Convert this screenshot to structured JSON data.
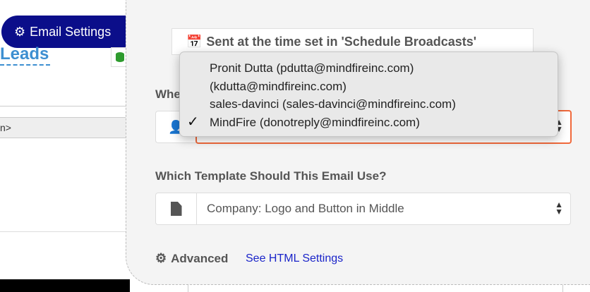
{
  "left": {
    "email_settings_tab": "Email Settings",
    "leads_link": "Leads",
    "table_header_fragment": "n>"
  },
  "panel": {
    "schedule_text": "Sent at the time set in 'Schedule Broadcasts'",
    "who_label_visible": "Whe",
    "from_dropdown": {
      "options": [
        "Pronit Dutta (pdutta@mindfireinc.com)",
        "(kdutta@mindfireinc.com)",
        "sales-davinci (sales-davinci@mindfireinc.com)",
        "MindFire (donotreply@mindfireinc.com)"
      ],
      "selected_index": 3
    },
    "template_label": "Which Template Should This Email Use?",
    "template_select_value": "Company: Logo and Button in Middle",
    "advanced_label": "Advanced",
    "html_settings_link": "See HTML Settings"
  },
  "icons": {
    "gears": "gears-icon",
    "calendar": "calendar-icon",
    "user": "user-icon",
    "file": "file-icon",
    "cog": "cog-icon",
    "database": "database-icon"
  },
  "colors": {
    "tab_bg": "#0b0e8a",
    "link_blue": "#3d8fd1",
    "focus_orange": "#f0693b",
    "accent_orange": "#ff6b35"
  }
}
